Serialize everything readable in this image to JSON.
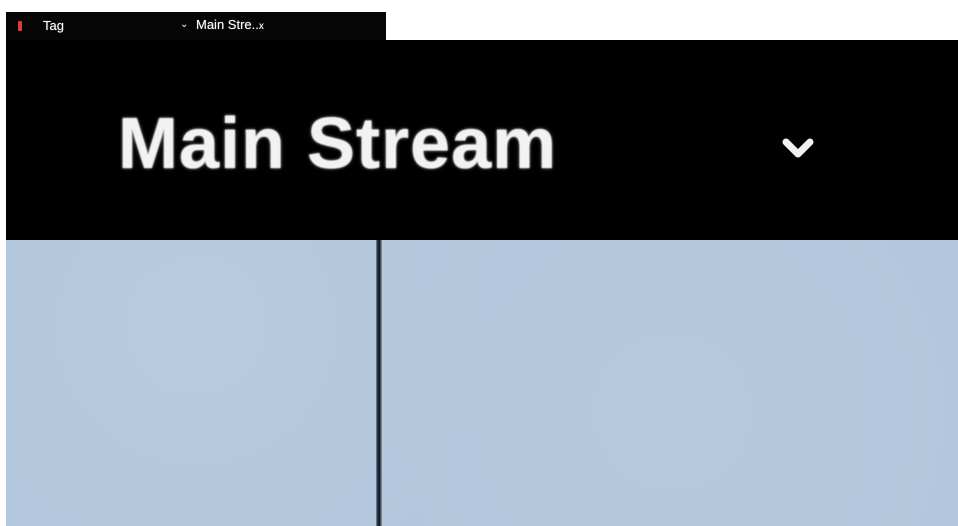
{
  "mini_bar": {
    "flag_icon": "red-flag-icon",
    "tag_label": "Tag",
    "chevron_icon": "chevron-down-icon",
    "stream_label": "Main Stre..",
    "stream_suffix": "x"
  },
  "header": {
    "stream_title": "Main Stream",
    "chevron_icon": "chevron-down-icon"
  },
  "video": {
    "background_color": "#b2c7dd",
    "divider_color": "#141a22"
  },
  "colors": {
    "flag": "#e53935",
    "header_bg": "#000000",
    "text": "#ffffff"
  }
}
